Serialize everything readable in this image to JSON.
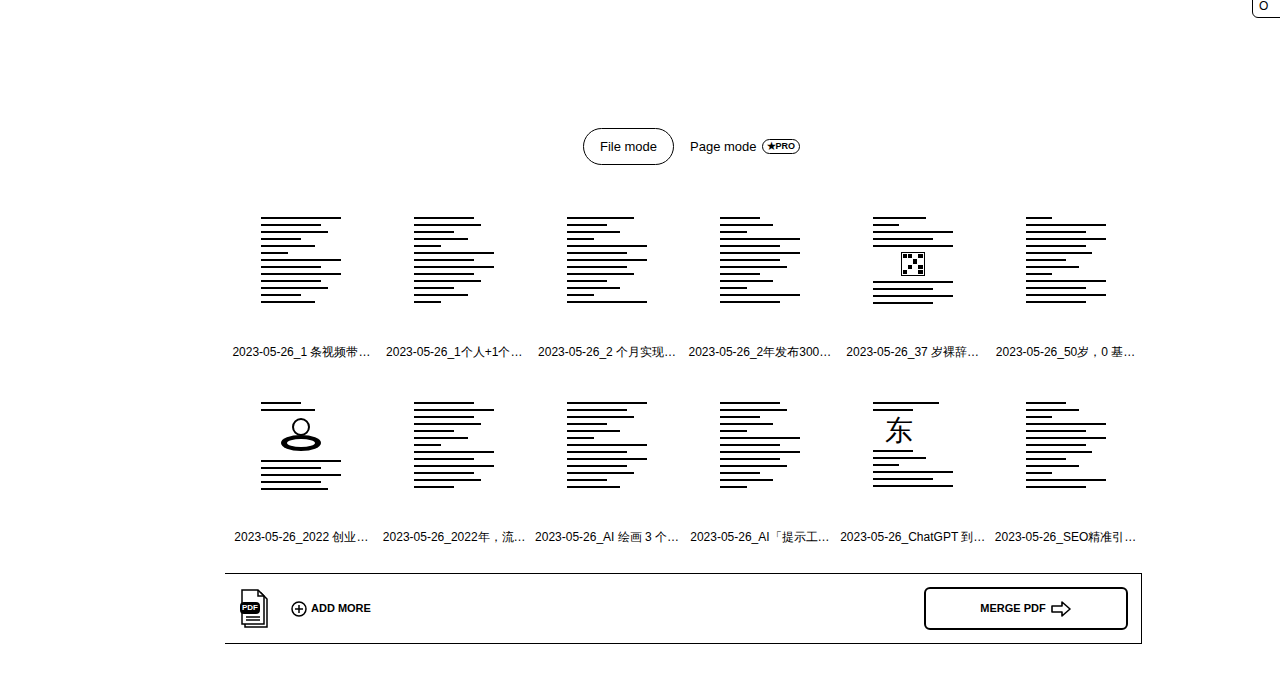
{
  "corner_button": {
    "label": "O"
  },
  "tabs": [
    {
      "label": "File mode",
      "selected": true
    },
    {
      "label": "Page mode",
      "selected": false,
      "badge": "★PRO"
    }
  ],
  "files": [
    {
      "name": "2023-05-26_1 条视频带…",
      "kind": "text"
    },
    {
      "name": "2023-05-26_1个人+1个…",
      "kind": "text"
    },
    {
      "name": "2023-05-26_2 个月实现…",
      "kind": "text"
    },
    {
      "name": "2023-05-26_2年发布300…",
      "kind": "text"
    },
    {
      "name": "2023-05-26_37 岁裸辞…",
      "kind": "qr"
    },
    {
      "name": "2023-05-26_50岁，0 基…",
      "kind": "text"
    },
    {
      "name": "2023-05-26_2022 创业…",
      "kind": "image"
    },
    {
      "name": "2023-05-26_2022年，流…",
      "kind": "text"
    },
    {
      "name": "2023-05-26_AI 绘画 3 个…",
      "kind": "text"
    },
    {
      "name": "2023-05-26_AI「提示工…",
      "kind": "text"
    },
    {
      "name": "2023-05-26_ChatGPT 到…",
      "kind": "glyph",
      "glyph": "东"
    },
    {
      "name": "2023-05-26_SEO精准引…",
      "kind": "text"
    }
  ],
  "bottom_bar": {
    "file_icon_text": "PDF",
    "add_more": "ADD MORE",
    "merge_button": "MERGE PDF"
  }
}
